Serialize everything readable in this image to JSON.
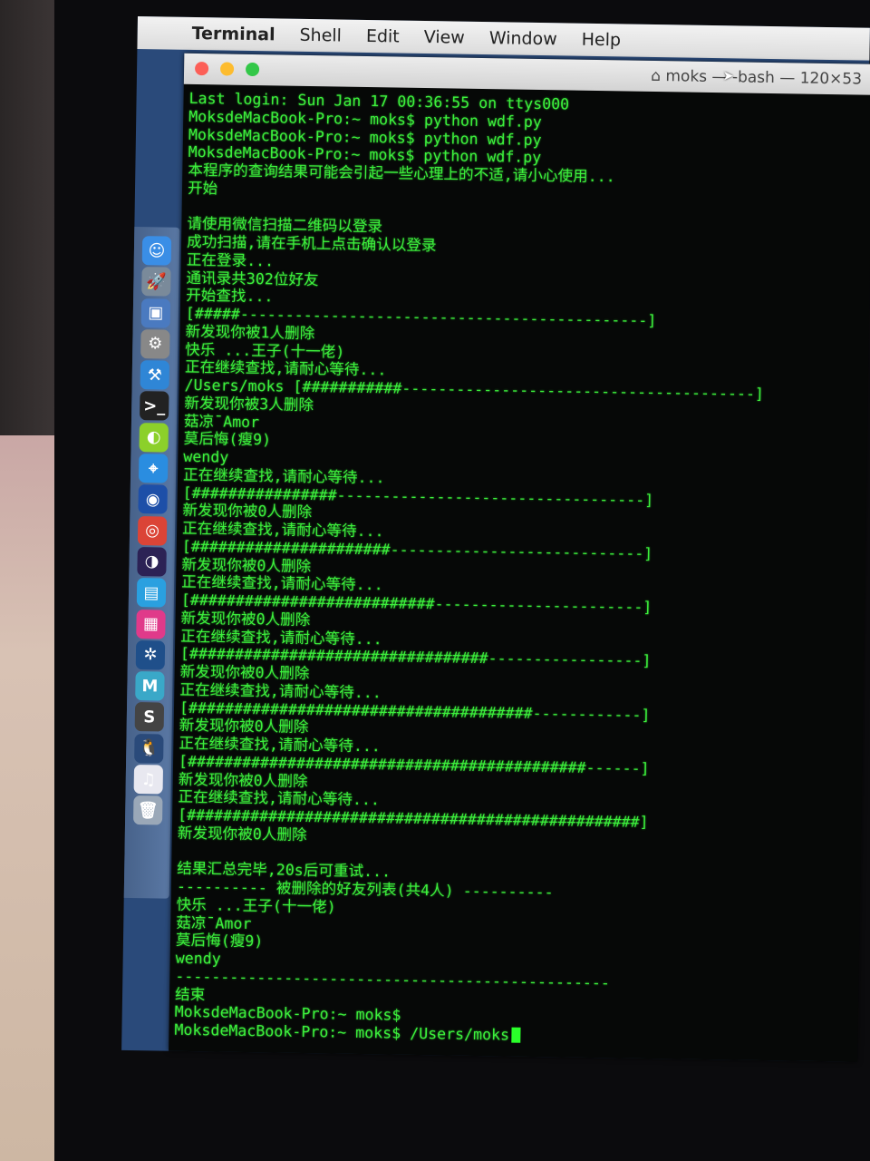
{
  "menubar": {
    "items": [
      "Terminal",
      "Shell",
      "Edit",
      "View",
      "Window",
      "Help"
    ]
  },
  "window": {
    "title": "moks — -bash — 120×53",
    "traffic_lights": {
      "close": "#fc5f57",
      "minimize": "#fdbc2e",
      "zoom": "#33c748"
    }
  },
  "terminal": {
    "text_color": "#3cf03c",
    "background": "#060807",
    "lines": [
      "Last login: Sun Jan 17 00:36:55 on ttys000",
      "MoksdeMacBook-Pro:~ moks$ python wdf.py",
      "MoksdeMacBook-Pro:~ moks$ python wdf.py",
      "MoksdeMacBook-Pro:~ moks$ python wdf.py",
      "本程序的查询结果可能会引起一些心理上的不适,请小心使用...",
      "开始",
      "",
      "请使用微信扫描二维码以登录",
      "成功扫描,请在手机上点击确认以登录",
      "正在登录...",
      "通讯录共302位好友",
      "开始查找...",
      "[#####---------------------------------------------]",
      "新发现你被1人删除",
      "快乐 ...王子(十一佬)",
      "正在继续查找,请耐心等待...",
      "/Users/moks [###########---------------------------------------]",
      "新发现你被3人删除",
      "菇凉¯Amor",
      "莫后悔(瘦9)",
      "wendy",
      "正在继续查找,请耐心等待...",
      "[################----------------------------------]",
      "新发现你被0人删除",
      "正在继续查找,请耐心等待...",
      "[######################----------------------------]",
      "新发现你被0人删除",
      "正在继续查找,请耐心等待...",
      "[###########################-----------------------]",
      "新发现你被0人删除",
      "正在继续查找,请耐心等待...",
      "[#################################-----------------]",
      "新发现你被0人删除",
      "正在继续查找,请耐心等待...",
      "[######################################------------]",
      "新发现你被0人删除",
      "正在继续查找,请耐心等待...",
      "[############################################------]",
      "新发现你被0人删除",
      "正在继续查找,请耐心等待...",
      "[##################################################]",
      "新发现你被0人删除",
      "",
      "结果汇总完毕,20s后可重试...",
      "---------- 被删除的好友列表(共4人) ----------",
      "快乐 ...王子(十一佬)",
      "菇凉¯Amor",
      "莫后悔(瘦9)",
      "wendy",
      "------------------------------------------------",
      "结束",
      "MoksdeMacBook-Pro:~ moks$",
      "MoksdeMacBook-Pro:~ moks$ /Users/moks"
    ]
  },
  "dock": {
    "icons": [
      {
        "name": "finder-icon",
        "color": "#3a8ee6",
        "glyph": "☺"
      },
      {
        "name": "launchpad-icon",
        "color": "#7a8a9a",
        "glyph": "🚀"
      },
      {
        "name": "preview-icon",
        "color": "#4a7ac0",
        "glyph": "▣"
      },
      {
        "name": "system-preferences-icon",
        "color": "#888",
        "glyph": "⚙"
      },
      {
        "name": "xcode-icon",
        "color": "#2f86d6",
        "glyph": "⚒"
      },
      {
        "name": "terminal-icon",
        "color": "#222",
        "glyph": ">_"
      },
      {
        "name": "app-green-icon",
        "color": "#8cd02a",
        "glyph": "◐"
      },
      {
        "name": "safari-icon",
        "color": "#2a8de0",
        "glyph": "⌖"
      },
      {
        "name": "firefox-icon",
        "color": "#1d4fa8",
        "glyph": "◉"
      },
      {
        "name": "chrome-icon",
        "color": "#db4437",
        "glyph": "◎"
      },
      {
        "name": "eclipse-icon",
        "color": "#2c2255",
        "glyph": "◑"
      },
      {
        "name": "app-blue-icon",
        "color": "#2aa0e0",
        "glyph": "▤"
      },
      {
        "name": "app-pink-icon",
        "color": "#e03a8a",
        "glyph": "▦"
      },
      {
        "name": "sourcetree-icon",
        "color": "#1f4f8a",
        "glyph": "✲"
      },
      {
        "name": "mou-icon",
        "color": "#3aa8c8",
        "glyph": "M"
      },
      {
        "name": "sublime-text-icon",
        "color": "#444",
        "glyph": "S"
      },
      {
        "name": "qq-icon",
        "color": "#2a4a7a",
        "glyph": "🐧"
      },
      {
        "name": "itunes-icon",
        "color": "#e8e8f0",
        "glyph": "♫"
      },
      {
        "name": "trash-icon",
        "color": "#9aa8b8",
        "glyph": "🗑"
      }
    ]
  }
}
